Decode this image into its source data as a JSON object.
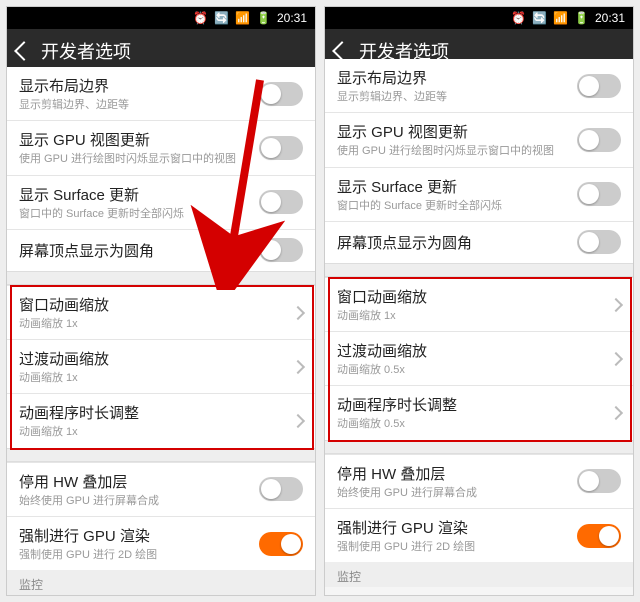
{
  "statusbar": {
    "time": "20:31"
  },
  "header": {
    "title": "开发者选项"
  },
  "left": {
    "rows": [
      {
        "title": "显示布局边界",
        "sub": "显示剪辑边界、边距等",
        "type": "toggle",
        "on": false
      },
      {
        "title": "显示 GPU 视图更新",
        "sub": "使用 GPU 进行绘图时闪烁显示窗口中的视图",
        "type": "toggle",
        "on": false
      },
      {
        "title": "显示 Surface 更新",
        "sub": "窗口中的 Surface 更新时全部闪烁",
        "type": "toggle",
        "on": false
      },
      {
        "title": "屏幕顶点显示为圆角",
        "sub": "",
        "type": "toggle",
        "on": false
      },
      {
        "title": "窗口动画缩放",
        "sub": "动画缩放 1x",
        "type": "nav"
      },
      {
        "title": "过渡动画缩放",
        "sub": "动画缩放 1x",
        "type": "nav"
      },
      {
        "title": "动画程序时长调整",
        "sub": "动画缩放 1x",
        "type": "nav"
      },
      {
        "title": "停用 HW 叠加层",
        "sub": "始终使用 GPU 进行屏幕合成",
        "type": "toggle",
        "on": false
      },
      {
        "title": "强制进行 GPU 渲染",
        "sub": "强制使用 GPU 进行 2D 绘图",
        "type": "toggle",
        "on": true
      }
    ],
    "section_label": "监控"
  },
  "right": {
    "rows": [
      {
        "title": "显示布局边界",
        "sub": "显示剪辑边界、边距等",
        "type": "toggle",
        "on": false,
        "cut": true
      },
      {
        "title": "显示 GPU 视图更新",
        "sub": "使用 GPU 进行绘图时闪烁显示窗口中的视图",
        "type": "toggle",
        "on": false
      },
      {
        "title": "显示 Surface 更新",
        "sub": "窗口中的 Surface 更新时全部闪烁",
        "type": "toggle",
        "on": false
      },
      {
        "title": "屏幕顶点显示为圆角",
        "sub": "",
        "type": "toggle",
        "on": false
      },
      {
        "title": "窗口动画缩放",
        "sub": "动画缩放 1x",
        "type": "nav"
      },
      {
        "title": "过渡动画缩放",
        "sub": "动画缩放 0.5x",
        "type": "nav"
      },
      {
        "title": "动画程序时长调整",
        "sub": "动画缩放 0.5x",
        "type": "nav"
      },
      {
        "title": "停用 HW 叠加层",
        "sub": "始终使用 GPU 进行屏幕合成",
        "type": "toggle",
        "on": false
      },
      {
        "title": "强制进行 GPU 渲染",
        "sub": "强制使用 GPU 进行 2D 绘图",
        "type": "toggle",
        "on": true
      }
    ],
    "section_label": "监控"
  }
}
